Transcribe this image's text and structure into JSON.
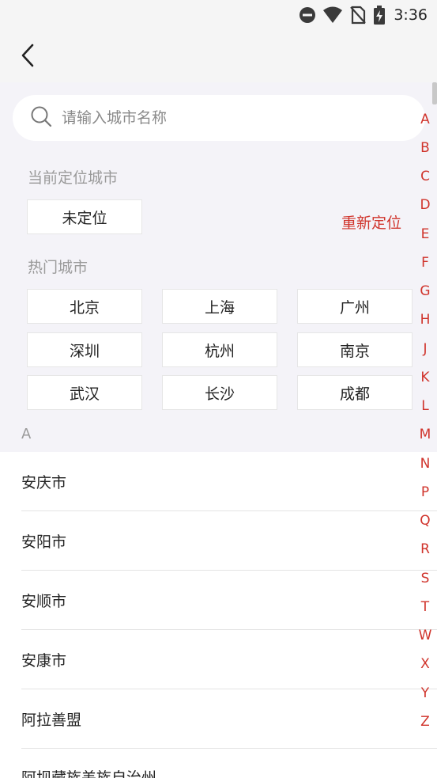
{
  "status_bar": {
    "time": "3:36",
    "icons": [
      "do-not-disturb-icon",
      "wifi-icon",
      "no-sim-icon",
      "battery-charging-icon"
    ]
  },
  "header": {
    "back_icon": "chevron-left-icon"
  },
  "search": {
    "placeholder": "请输入城市名称",
    "value": "",
    "icon": "search-icon"
  },
  "current_location": {
    "label": "当前定位城市",
    "value": "未定位",
    "relocate_label": "重新定位"
  },
  "hot_cities": {
    "label": "热门城市",
    "items": [
      "北京",
      "上海",
      "广州",
      "深圳",
      "杭州",
      "南京",
      "武汉",
      "长沙",
      "成都"
    ]
  },
  "city_group": {
    "header": "A",
    "items": [
      "安庆市",
      "安阳市",
      "安顺市",
      "安康市",
      "阿拉善盟",
      "阿坝藏族羌族自治州"
    ]
  },
  "alphabet_index": [
    "A",
    "B",
    "C",
    "D",
    "E",
    "F",
    "G",
    "H",
    "J",
    "K",
    "L",
    "M",
    "N",
    "P",
    "Q",
    "R",
    "S",
    "T",
    "W",
    "X",
    "Y",
    "Z"
  ],
  "colors": {
    "accent": "#d0342c",
    "background": "#f4f3f8",
    "muted_text": "#9a9a9a"
  }
}
